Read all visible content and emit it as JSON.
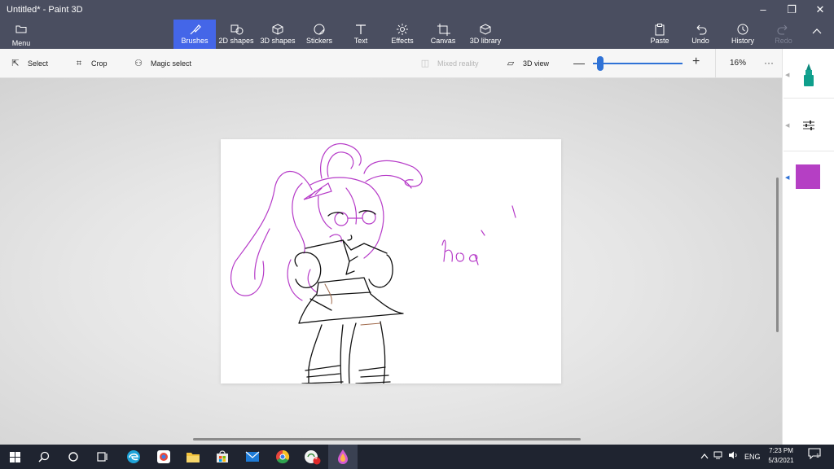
{
  "window": {
    "title": "Untitled* - Paint 3D",
    "controls": {
      "minimize": "–",
      "restore": "❐",
      "close": "✕"
    }
  },
  "ribbon": {
    "menu_label": "Menu",
    "tools": [
      {
        "label": "Brushes",
        "icon": "brush-icon",
        "active": true
      },
      {
        "label": "2D shapes",
        "icon": "2d-shapes-icon"
      },
      {
        "label": "3D shapes",
        "icon": "3d-shapes-icon"
      },
      {
        "label": "Stickers",
        "icon": "stickers-icon"
      },
      {
        "label": "Text",
        "icon": "text-icon"
      },
      {
        "label": "Effects",
        "icon": "effects-icon"
      },
      {
        "label": "Canvas",
        "icon": "canvas-icon"
      },
      {
        "label": "3D library",
        "icon": "3d-library-icon"
      }
    ],
    "right_tools": [
      {
        "label": "Paste",
        "icon": "paste-icon"
      },
      {
        "label": "Undo",
        "icon": "undo-icon"
      },
      {
        "label": "History",
        "icon": "history-icon"
      },
      {
        "label": "Redo",
        "icon": "redo-icon",
        "disabled": true
      }
    ]
  },
  "subbar": {
    "select_label": "Select",
    "crop_label": "Crop",
    "magic_select_label": "Magic select",
    "mixed_reality_label": "Mixed reality",
    "view3d_label": "3D view",
    "zoom_value": "16%",
    "zoom_level": 0.08,
    "more_label": "···"
  },
  "canvas": {
    "drawing_text": "hoa",
    "colors": {
      "outline": "#111111",
      "accent": "#b63bc8"
    }
  },
  "sidepanel": {
    "selected_color": "#b53fc4",
    "tool": "marker-icon"
  },
  "taskbar": {
    "apps": [
      "start-icon",
      "search-icon",
      "cortana-icon",
      "task-view-icon",
      "edge-icon",
      "chrome-app-icon",
      "file-explorer-icon",
      "store-icon",
      "mail-icon",
      "chrome-icon",
      "app-icon",
      "paint3d-icon"
    ],
    "badge_count": "1",
    "language": "ENG",
    "time": "7:23 PM",
    "date": "5/3/2021",
    "notification_count": "1"
  }
}
